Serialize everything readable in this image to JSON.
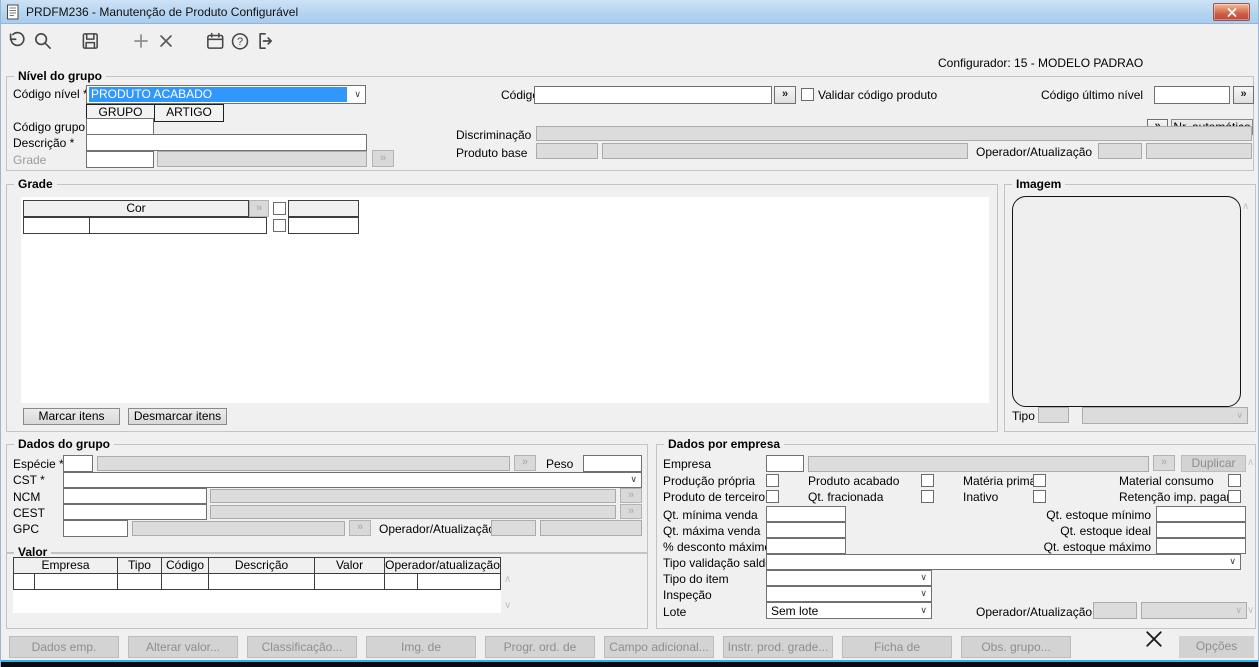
{
  "window": {
    "title": "PRDFM236 - Manutenção de Produto Configurável"
  },
  "header": {
    "configurador_label": "Configurador: 15 - MODELO PADRAO"
  },
  "glyphs": {
    "more": "»",
    "chevron_down": "∨",
    "chevron_up": "∧"
  },
  "toolbar": {
    "icons": [
      "undo-icon",
      "search-icon",
      "save-icon",
      "add-icon",
      "delete-icon",
      "calendar-icon",
      "help-icon",
      "exit-icon"
    ]
  },
  "nivel_grupo": {
    "legend": "Nível do grupo",
    "codigo_nivel_label": "Código nível *",
    "codigo_nivel_value": "PRODUTO ACABADO",
    "tabs": [
      "GRUPO",
      "ARTIGO"
    ],
    "codigo_label": "Código",
    "validar_checkbox_label": "Validar código produto",
    "codigo_ultimo_nivel_label": "Código último nível",
    "nr_automatico_button": "Nr. automático",
    "codigo_grupo_label": "Código grupo *",
    "descricao_label": "Descrição *",
    "grade_label": "Grade",
    "discriminacao_label": "Discriminação",
    "produto_base_label": "Produto base",
    "operador_atualizacao_label": "Operador/Atualização"
  },
  "grade": {
    "legend": "Grade",
    "cor_header": "Cor",
    "marcar_button": "Marcar itens",
    "desmarcar_button": "Desmarcar itens"
  },
  "imagem": {
    "legend": "Imagem",
    "tipo_label": "Tipo"
  },
  "dados_grupo": {
    "legend": "Dados do grupo",
    "especie_label": "Espécie *",
    "peso_label": "Peso",
    "cst_label": "CST *",
    "ncm_label": "NCM",
    "cest_label": "CEST",
    "gpc_label": "GPC",
    "operador_atualizacao_label": "Operador/Atualização"
  },
  "valor": {
    "legend": "Valor",
    "columns": [
      "Empresa",
      "Tipo",
      "Código",
      "Descrição",
      "Valor",
      "Operador/atualização"
    ]
  },
  "dados_empresa": {
    "legend": "Dados por empresa",
    "empresa_label": "Empresa",
    "duplicar_button": "Duplicar",
    "checkbox_labels_row1": [
      "Produção própria",
      "Produto acabado",
      "Matéria prima",
      "Material consumo"
    ],
    "checkbox_labels_row2": [
      "Produto de terceiro",
      "Qt. fracionada",
      "Inativo",
      "Retenção imp. pagar"
    ],
    "qt_minima_venda_label": "Qt. mínima venda",
    "qt_maxima_venda_label": "Qt. máxima venda",
    "desconto_maximo_label": "% desconto máximo",
    "qt_estoque_minimo_label": "Qt. estoque mínimo",
    "qt_estoque_ideal_label": "Qt. estoque ideal",
    "qt_estoque_maximo_label": "Qt. estoque máximo",
    "tipo_validacao_saldo_label": "Tipo validação saldo",
    "tipo_do_item_label": "Tipo do item",
    "inspecao_label": "Inspeção",
    "lote_label": "Lote",
    "lote_value": "Sem lote",
    "operador_atualizacao_label": "Operador/Atualização"
  },
  "footer": {
    "buttons": [
      "Dados emp. grade...",
      "Alterar valor...",
      "Classificação...",
      "Img. de prod/grupo...",
      "Progr. ord. de prod...",
      "Campo adicional...",
      "Instr. prod. grade...",
      "Ficha de Consumo...",
      "Obs. grupo..."
    ],
    "opcoes_button": "Opções"
  },
  "colors": {
    "titlebar": "#b4d3f0",
    "selection": "#3297fd",
    "close_button": "#cd5a47",
    "footer_strip_line": "#27b7ea",
    "footer_strip_bg": "#0a0a12"
  }
}
